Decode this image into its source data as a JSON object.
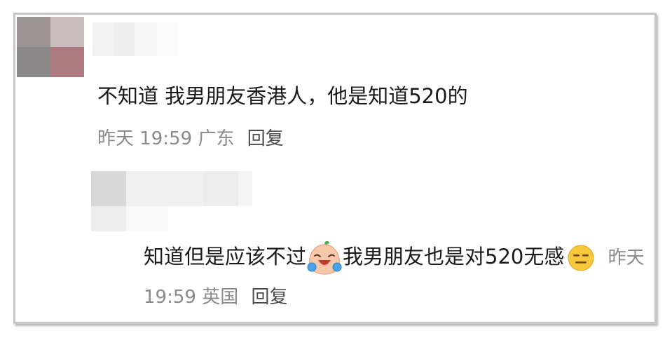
{
  "colors": {
    "text": "#1a1a1a",
    "meta": "#8a8a8a",
    "reply": "#4a4a4a",
    "frame_border": "#c6c6c6"
  },
  "comment": {
    "avatar_pixels": [
      "#9c9494",
      "#c9bcbc",
      "#8a8888",
      "#ad7a80"
    ],
    "name_blur_pixels": [
      "#f2f2f2",
      "#eeeeee",
      "#f6f6f6",
      "#fafafa"
    ],
    "text": "不知道 我男朋友香港人，他是知道520的",
    "time": "昨天 19:59",
    "location": "广东",
    "reply_label": "回复"
  },
  "reply": {
    "avatar_pixels": [
      "#d8d8d8",
      "#efefef",
      "#ececec",
      "#f8f8f8"
    ],
    "name_blur_pixels": [
      "#f0f0f0",
      "#ececec",
      "#f4f4f4"
    ],
    "text_part1": "知道但是应该不过",
    "emoji1": "laughing-crying-peach-emoji",
    "text_part2": "我男朋友也是对520无感",
    "emoji2": "expressionless-face-emoji",
    "time": "昨天 19:59",
    "location": "英国",
    "reply_label": "回复"
  }
}
